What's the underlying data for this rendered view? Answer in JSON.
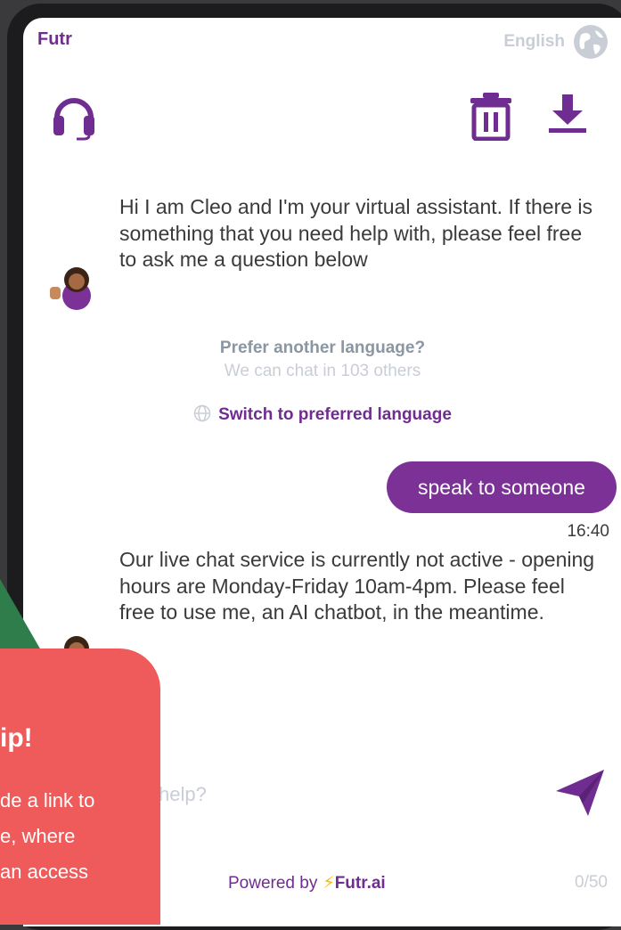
{
  "header": {
    "brand": "Futr",
    "language": "English"
  },
  "messages": {
    "greeting": "Hi I am Cleo and I'm your virtual assistant. If there is something that you need help with, please feel free to ask me a question below",
    "language_prompt": {
      "question": "Prefer another language?",
      "subtitle": "We can chat in 103 others",
      "link": "Switch to preferred language"
    },
    "user_message": "speak to someone",
    "user_time": "16:40",
    "reply": "Our live chat service is currently not active - opening hours are Monday-Friday 10am-4pm. Please feel free to use me, an AI chatbot, in the meantime."
  },
  "composer": {
    "placeholder": "help?",
    "counter": "0/50"
  },
  "footer": {
    "powered_prefix": "Powered by",
    "powered_brand": "Futr.ai"
  },
  "tip_overlay": {
    "title": "ip!",
    "lines": [
      "de a link to",
      "e, where",
      "an access",
      ""
    ]
  },
  "colors": {
    "brand": "#6f2c91",
    "bubble": "#7b3196",
    "tip": "#ef5b5b",
    "accent_green": "#2e7d4a"
  },
  "icons": [
    "globe-icon",
    "headset-icon",
    "trash-icon",
    "download-icon",
    "send-icon",
    "bolt-icon"
  ]
}
